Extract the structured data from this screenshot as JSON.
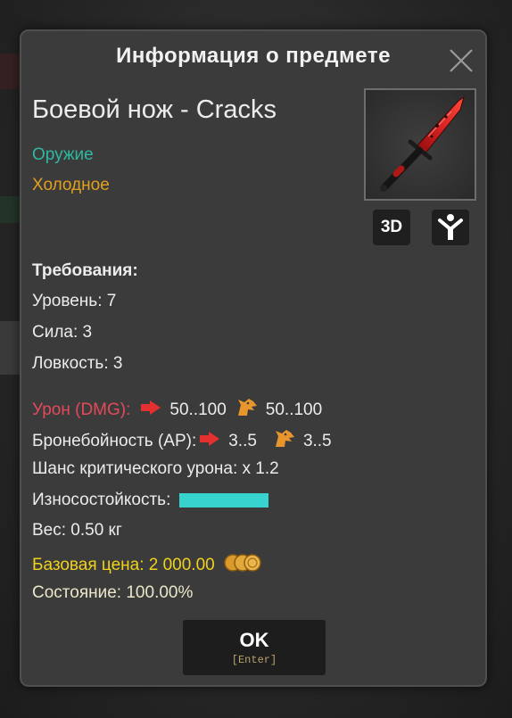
{
  "dialog": {
    "title": "Информация о предмете",
    "close_icon": "close-icon"
  },
  "item": {
    "name": "Боевой нож - Cracks",
    "category": "Оружие",
    "subcategory": "Холодное",
    "image_icon": "red-combat-knife-icon",
    "view_3d_label": "3D",
    "figure_icon": "character-figure-icon"
  },
  "requirements": {
    "title": "Требования:",
    "level": "Уровень: 7",
    "strength": "Сила: 3",
    "agility": "Ловкость: 3"
  },
  "stats": {
    "damage_label": "Урон (DMG):",
    "damage_melee": "50..100",
    "damage_special": "50..100",
    "ap_label": "Бронебойность (AP):",
    "ap_melee": "3..5",
    "ap_special": "3..5",
    "crit": "Шанс критического урона: x 1.2",
    "durability_label": "Износостойкость:",
    "durability_fraction": 1.0,
    "weight": "Вес: 0.50 кг",
    "price": "Базовая цена: 2 000.00",
    "price_icon": "coins-icon",
    "condition": "Состояние: 100.00%"
  },
  "colors": {
    "category": "#2fb8a0",
    "subcategory": "#e3a01f",
    "damage_label": "#e34a5a",
    "price": "#f0d21c",
    "durability_bar": "#37d3cf",
    "arrow": "#e53030",
    "beast": "#e8952e"
  },
  "ok_button": {
    "label": "OK",
    "hint": "[Enter]"
  }
}
